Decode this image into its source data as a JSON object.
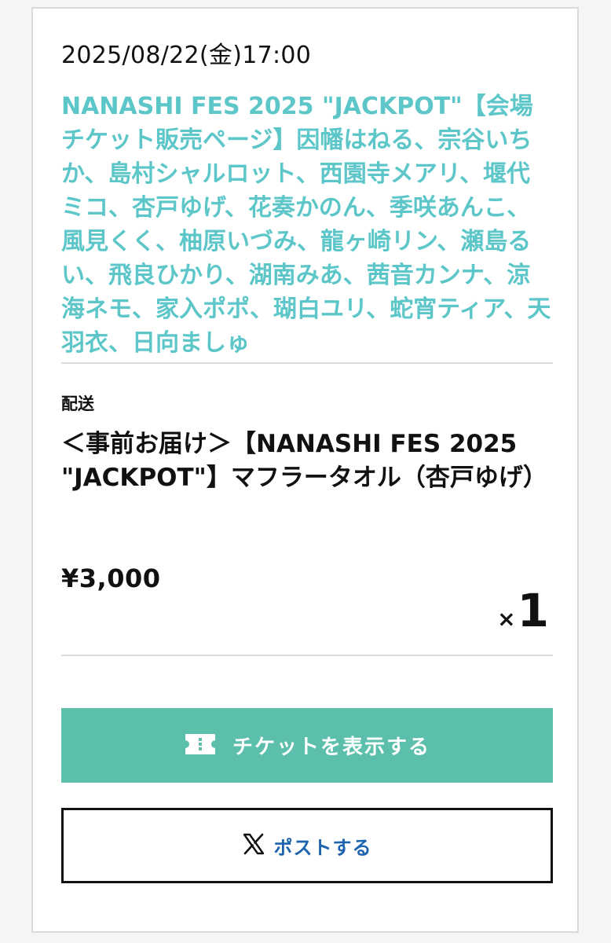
{
  "order": {
    "datetime": "2025/08/22(金)17:00",
    "event_title": "NANASHI FES 2025 \"JACKPOT\"【会場チケット販売ページ】因幡はねる、宗谷いちか、島村シャルロット、西園寺メアリ、堰代ミコ、杏戸ゆげ、花奏かのん、季咲あんこ、風見くく、柚原いづみ、龍ヶ崎リン、瀬島るい、飛良ひかり、湖南みあ、茜音カンナ、涼海ネモ、家入ポポ、瑚白ユリ、蛇宵ティア、天羽衣、日向ましゅ"
  },
  "item": {
    "delivery_label": "配送",
    "product_name": "＜事前お届け＞【NANASHI FES 2025 \"JACKPOT\"】マフラータオル（杏戸ゆげ）",
    "price": "¥3,000",
    "quantity_prefix": "×",
    "quantity": "1"
  },
  "actions": {
    "ticket_button_label": "チケットを表示する",
    "ticket_button_icon": "ticket-icon",
    "post_button_label": "ポストする",
    "post_button_icon": "x-logo-icon"
  },
  "colors": {
    "event_title": "#5cc6c8",
    "ticket_button_bg": "#5bbfab",
    "post_button_text": "#1d63ad"
  }
}
